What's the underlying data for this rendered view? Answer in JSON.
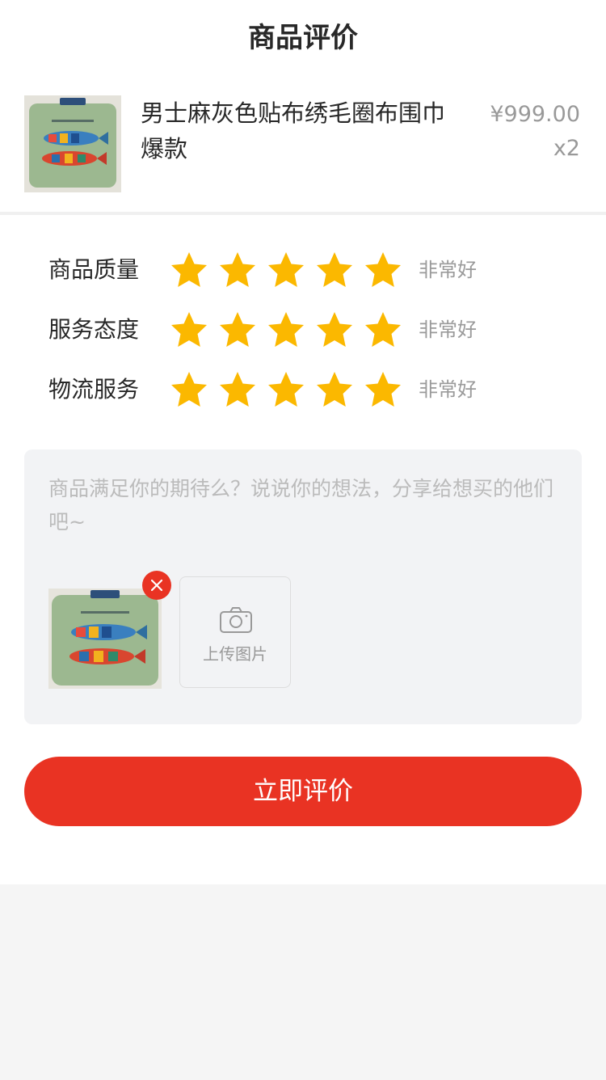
{
  "header": {
    "title": "商品评价"
  },
  "product": {
    "name": "男士麻灰色贴布绣毛圈布围巾爆款",
    "price": "¥999.00",
    "quantity": "x2",
    "image_icon": "pillow-fish-image"
  },
  "ratings": [
    {
      "label": "商品质量",
      "stars": 5,
      "max": 5,
      "text": "非常好"
    },
    {
      "label": "服务态度",
      "stars": 5,
      "max": 5,
      "text": "非常好"
    },
    {
      "label": "物流服务",
      "stars": 5,
      "max": 5,
      "text": "非常好"
    }
  ],
  "comment": {
    "value": "",
    "placeholder": "商品满足你的期待么？说说你的想法，分享给想买的他们吧~"
  },
  "upload": {
    "label": "上传图片",
    "icon": "camera-icon",
    "remove_icon": "close-icon",
    "thumbnail_icon": "pillow-fish-image"
  },
  "submit": {
    "label": "立即评价"
  },
  "colors": {
    "accent": "#e93323",
    "star": "#fbb800",
    "text_primary": "#282828",
    "text_secondary": "#999999",
    "page_background": "#f5f5f5",
    "comment_background": "#f2f3f5"
  }
}
